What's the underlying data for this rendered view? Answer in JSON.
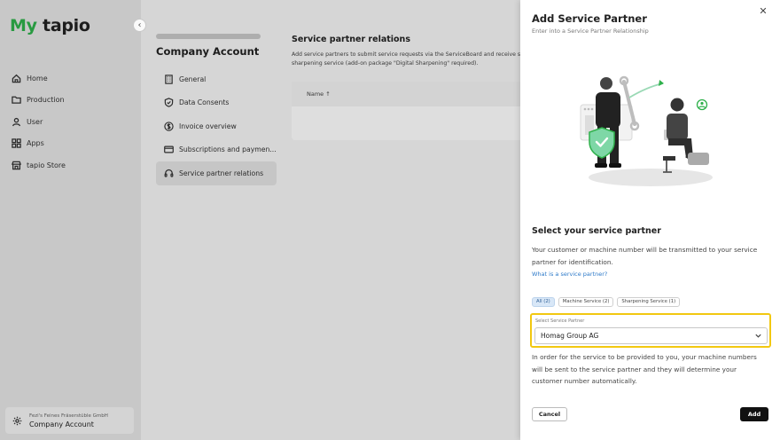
{
  "app": {
    "logo_my": "My",
    "logo_tapio": "tapio",
    "collapse_icon": "‹"
  },
  "sidebar": {
    "items": [
      {
        "label": "Home",
        "icon": "home-icon"
      },
      {
        "label": "Production",
        "icon": "folder-icon"
      },
      {
        "label": "User",
        "icon": "user-icon"
      },
      {
        "label": "Apps",
        "icon": "apps-grid-icon"
      },
      {
        "label": "tapio Store",
        "icon": "store-icon"
      }
    ],
    "account": {
      "org": "Fezi's Feines Fräserstüble GmbH",
      "label": "Company Account"
    }
  },
  "page": {
    "title": "Company Account",
    "subnav": [
      {
        "label": "General",
        "icon": "building-icon"
      },
      {
        "label": "Data Consents",
        "icon": "shield-check-icon"
      },
      {
        "label": "Invoice overview",
        "icon": "dollar-circle-icon"
      },
      {
        "label": "Subscriptions and paymen...",
        "icon": "card-icon"
      },
      {
        "label": "Service partner relations",
        "icon": "headset-icon"
      }
    ],
    "section": {
      "title": "Service partner relations",
      "description": "Add service partners to submit service requests via the ServiceBoard and receive s sharpening service (add-on package \"Digital Sharpening\" required).",
      "table_header": "Name ↑"
    }
  },
  "drawer": {
    "title": "Add Service Partner",
    "subtitle": "Enter into a Service Partner Relationship",
    "close_icon": "✕",
    "heading": "Select your service partner",
    "intro": "Your customer or machine number will be transmitted to your service partner for identification.",
    "link": "What is a service partner?",
    "chips": [
      {
        "label": "All (2)",
        "active": true
      },
      {
        "label": "Machine Service (2)",
        "active": false
      },
      {
        "label": "Sharpening Service (1)",
        "active": false
      }
    ],
    "select": {
      "label": "Select Service Partner",
      "value": "Homag Group AG"
    },
    "note": "In order for the service to be provided to you, your machine numbers will be sent to the service partner and they will determine your customer number automatically.",
    "cancel": "Cancel",
    "add": "Add"
  },
  "colors": {
    "brand_green": "#2fb14b",
    "highlight": "#f2c811",
    "link": "#2d7ac9",
    "primary_button": "#111111"
  }
}
